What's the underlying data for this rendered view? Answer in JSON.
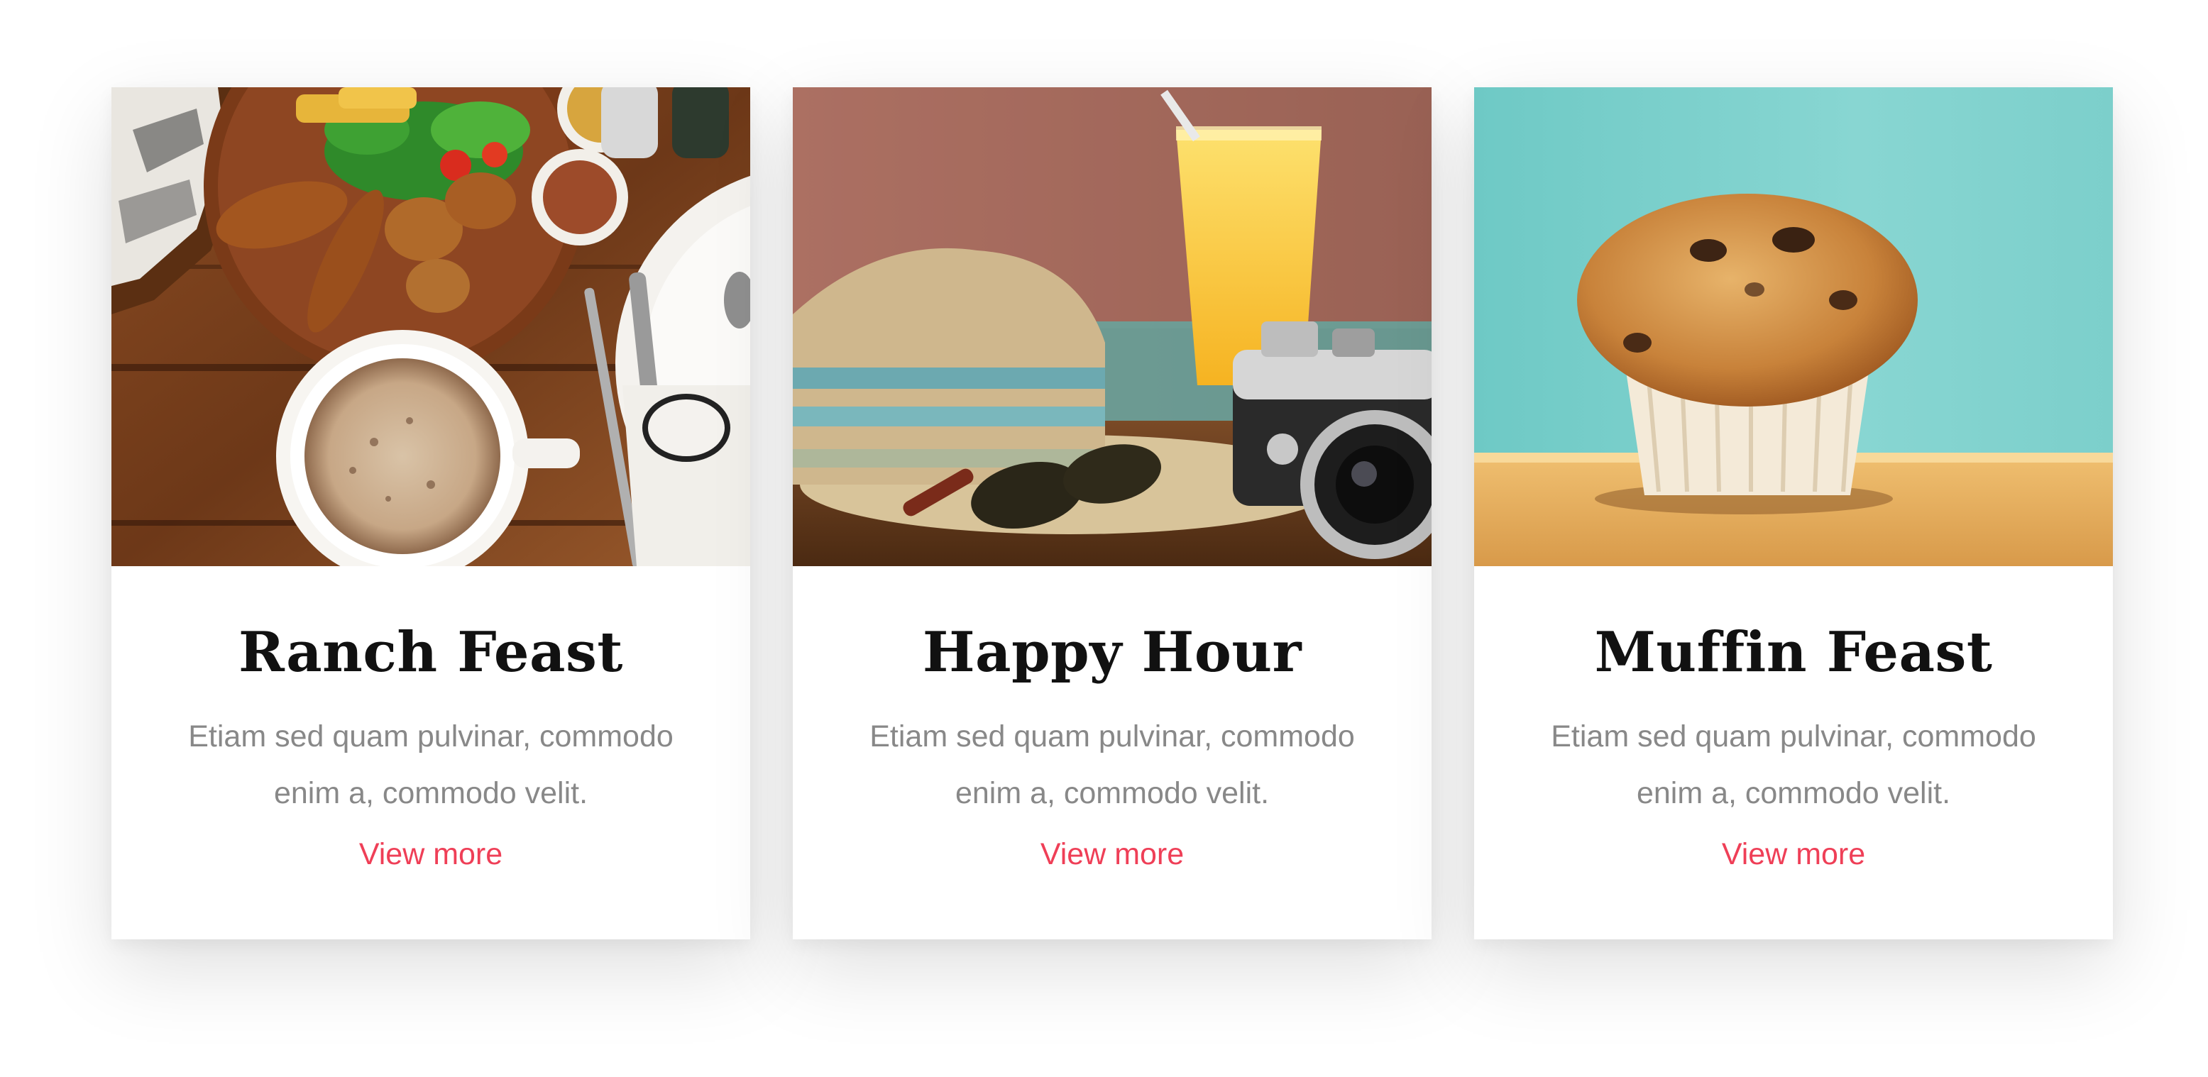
{
  "colors": {
    "background": "#ffffff",
    "title": "#111111",
    "description": "#888888",
    "link_accent": "#ef3f57"
  },
  "cards": [
    {
      "title": "Ranch Feast",
      "description": "Etiam sed quam pulvinar, commodo enim a, commodo velit.",
      "link_label": "View more",
      "image_alt": "coffee-and-breakfast-photo"
    },
    {
      "title": "Happy Hour",
      "description": "Etiam sed quam pulvinar, commodo enim a, commodo velit.",
      "link_label": "View more",
      "image_alt": "hat-juice-camera-photo"
    },
    {
      "title": "Muffin Feast",
      "description": "Etiam sed quam pulvinar, commodo enim a, commodo velit.",
      "link_label": "View more",
      "image_alt": "muffin-photo"
    }
  ]
}
